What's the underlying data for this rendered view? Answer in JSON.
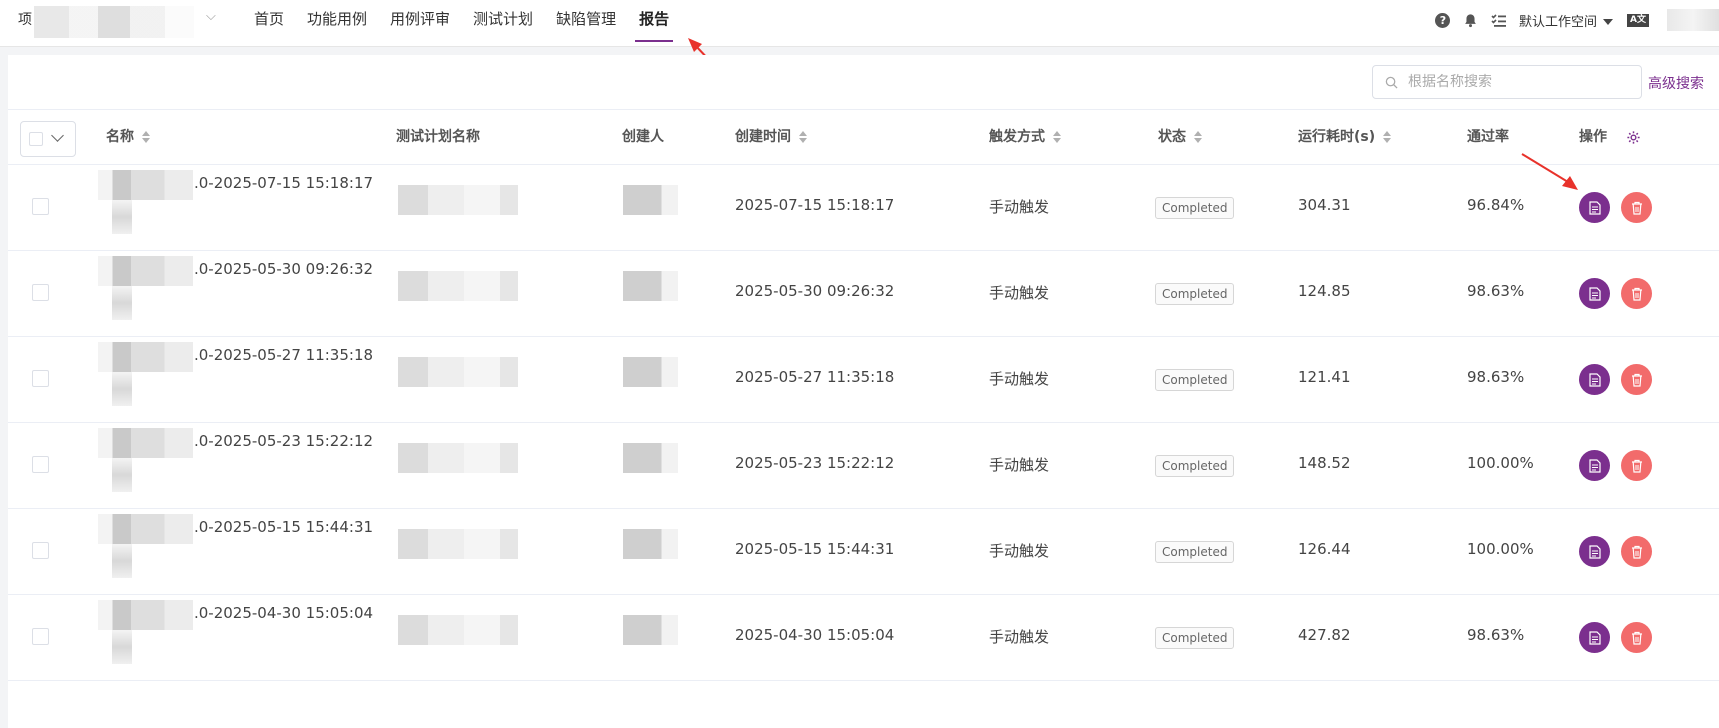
{
  "header": {
    "project_prefix": "项",
    "nav": [
      {
        "label": "首页"
      },
      {
        "label": "功能用例"
      },
      {
        "label": "用例评审"
      },
      {
        "label": "测试计划"
      },
      {
        "label": "缺陷管理"
      },
      {
        "label": "报告",
        "active": true
      }
    ],
    "workspace": "默认工作空间",
    "lang_icon": "A文"
  },
  "toolbar": {
    "search_placeholder": "根据名称搜索",
    "advanced_search": "高级搜索"
  },
  "table": {
    "columns": {
      "name": "名称",
      "plan_name": "测试计划名称",
      "creator": "创建人",
      "created_time": "创建时间",
      "trigger": "触发方式",
      "status": "状态",
      "duration": "运行耗时(s)",
      "pass_rate": "通过率",
      "actions": "操作"
    },
    "rows": [
      {
        "name_suffix": ".0-2025-07-15 15:18:17",
        "created_time": "2025-07-15 15:18:17",
        "trigger": "手动触发",
        "status": "Completed",
        "duration": "304.31",
        "pass_rate": "96.84%"
      },
      {
        "name_suffix": ".0-2025-05-30 09:26:32",
        "created_time": "2025-05-30 09:26:32",
        "trigger": "手动触发",
        "status": "Completed",
        "duration": "124.85",
        "pass_rate": "98.63%"
      },
      {
        "name_suffix": ".0-2025-05-27 11:35:18",
        "created_time": "2025-05-27 11:35:18",
        "trigger": "手动触发",
        "status": "Completed",
        "duration": "121.41",
        "pass_rate": "98.63%"
      },
      {
        "name_suffix": ".0-2025-05-23 15:22:12",
        "created_time": "2025-05-23 15:22:12",
        "trigger": "手动触发",
        "status": "Completed",
        "duration": "148.52",
        "pass_rate": "100.00%"
      },
      {
        "name_suffix": ".0-2025-05-15 15:44:31",
        "created_time": "2025-05-15 15:44:31",
        "trigger": "手动触发",
        "status": "Completed",
        "duration": "126.44",
        "pass_rate": "100.00%"
      },
      {
        "name_suffix": ".0-2025-04-30 15:05:04",
        "created_time": "2025-04-30 15:05:04",
        "trigger": "手动触发",
        "status": "Completed",
        "duration": "427.82",
        "pass_rate": "98.63%"
      }
    ]
  },
  "colors": {
    "accent": "#7b2f8e",
    "delete": "#f26b6b",
    "annotation_arrow": "#e8322b"
  }
}
